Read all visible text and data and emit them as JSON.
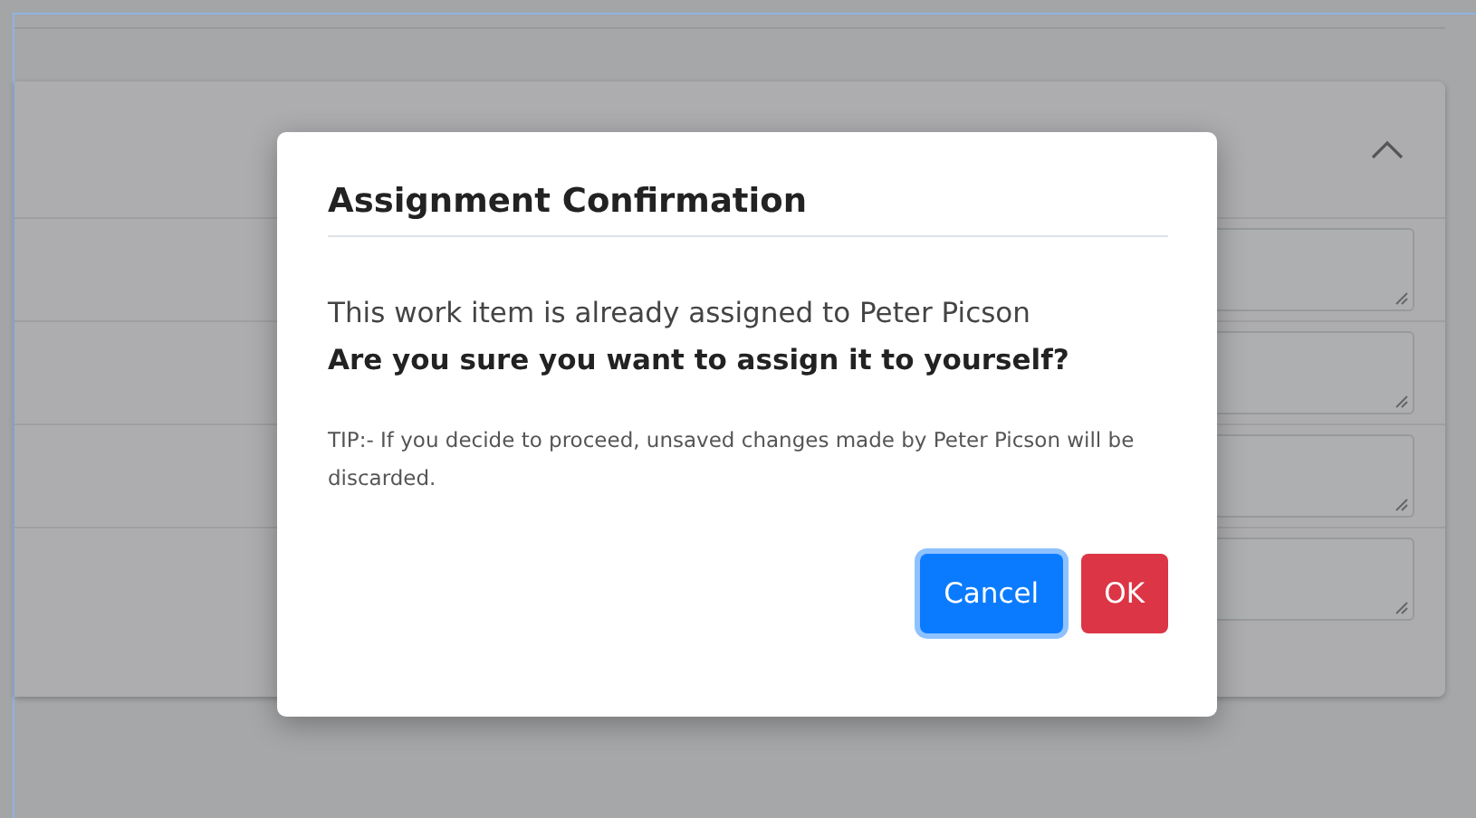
{
  "background_panel": {
    "expanded": true,
    "fields": [
      {
        "kind": "textarea"
      },
      {
        "kind": "textarea"
      },
      {
        "kind": "textarea"
      },
      {
        "kind": "textarea"
      }
    ]
  },
  "dialog": {
    "title": "Assignment Confirmation",
    "message": "This work item is already assigned to Peter Picson",
    "question": "Are you sure you want to assign it to yourself?",
    "tip": "TIP:- If you decide to proceed, unsaved changes made by Peter Picson will be discarded.",
    "buttons": [
      {
        "label": "Cancel",
        "kind": "primary",
        "focused": true
      },
      {
        "label": "OK",
        "kind": "danger",
        "focused": false
      }
    ]
  }
}
